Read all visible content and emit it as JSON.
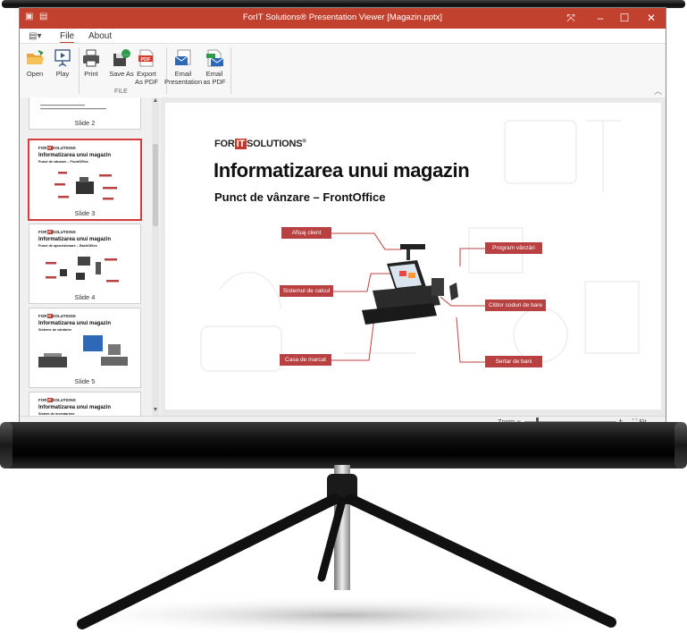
{
  "window": {
    "title": "ForIT Solutions® Presentation Viewer [Magazin.pptx]"
  },
  "tabs": [
    {
      "label": "File"
    },
    {
      "label": "About"
    }
  ],
  "ribbon": {
    "open": "Open",
    "play": "Play",
    "print": "Print",
    "save_as": "Save As",
    "export_pdf": [
      "Export",
      "As PDF"
    ],
    "email_presentation": [
      "Email",
      "Presentation"
    ],
    "email_pdf": [
      "Email",
      "as PDF"
    ],
    "group_label": "FILE"
  },
  "thumbnails": [
    {
      "label": "Slide 2"
    },
    {
      "label": "Slide 3",
      "logo": "FOR",
      "logo_accent": "IT",
      "logo_end": "SOLUTIONS",
      "title": "Informatizarea unui magazin",
      "subtitle": "Punct de vânzare – FrontOffice"
    },
    {
      "label": "Slide 4",
      "logo": "FOR",
      "logo_accent": "IT",
      "logo_end": "SOLUTIONS",
      "title": "Informatizarea unui magazin",
      "subtitle": "Punct de aprovizionare – BackOffice"
    },
    {
      "label": "Slide 5",
      "logo": "FOR",
      "logo_accent": "IT",
      "logo_end": "SOLUTIONS",
      "title": "Informatizarea unui magazin",
      "subtitle": "Sisteme de cântărire"
    },
    {
      "logo": "FOR",
      "logo_accent": "IT",
      "logo_end": "SOLUTIONS",
      "title": "Informatizarea unui magazin",
      "subtitle": "Sistem de inventariere"
    }
  ],
  "slide": {
    "logo": "FOR",
    "logo_accent": "IT",
    "logo_end": "SOLUTIONS",
    "title": "Informatizarea unui magazin",
    "subtitle": "Punct de vânzare – FrontOffice",
    "labels": {
      "afisaj": "Afișaj client",
      "sistemul": "Sistemul de calcul",
      "casa": "Casa de marcat",
      "program": "Program vânzări",
      "cititor": "Cititor coduri de bare",
      "sertar": "Sertar de bani"
    }
  },
  "status": {
    "zoom_label": "Zoom",
    "fit_label": "Fit"
  },
  "colors": {
    "titlebar": "#c2412e",
    "accent_label": "#b84040",
    "selected_border": "#d63b3b"
  }
}
